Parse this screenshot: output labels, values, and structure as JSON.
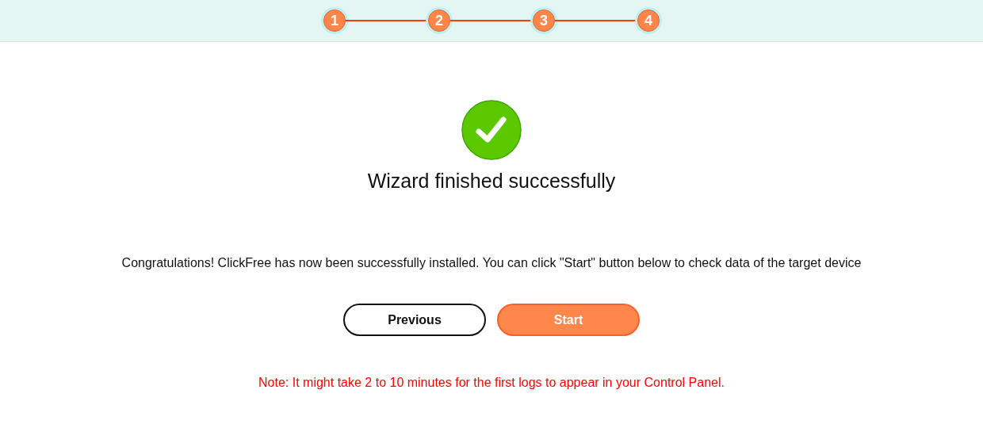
{
  "steps": [
    {
      "label": "1"
    },
    {
      "label": "2"
    },
    {
      "label": "3"
    },
    {
      "label": "4"
    }
  ],
  "title": "Wizard finished successfully",
  "message": "Congratulations! ClickFree has now been successfully installed. You can click \"Start\" button below to check data of the target device",
  "buttons": [
    {
      "label": "Previous",
      "kind": "secondary"
    },
    {
      "label": "Start",
      "kind": "primary"
    }
  ],
  "note": "Note: It might take 2 to 10 minutes for the first logs to appear in your Control Panel."
}
